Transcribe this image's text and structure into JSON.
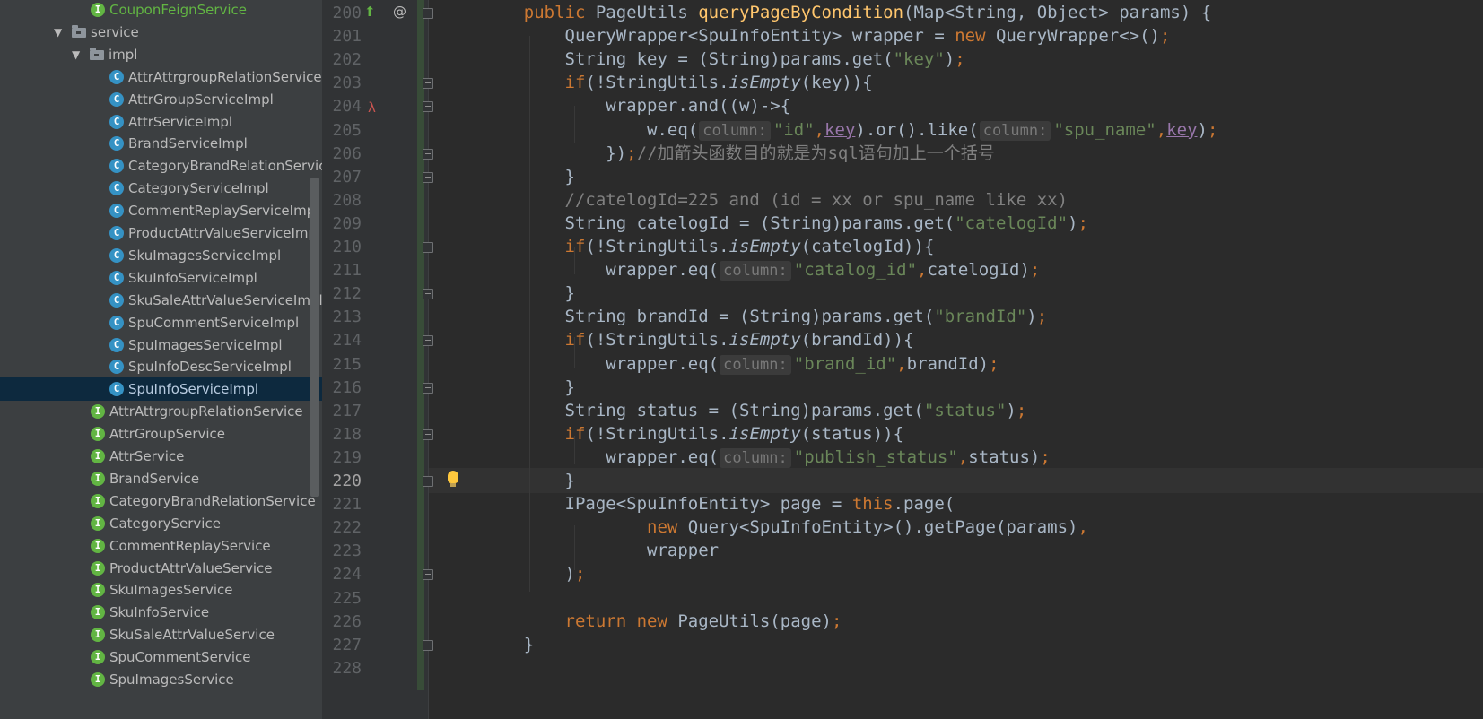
{
  "project_tree": {
    "items": [
      {
        "label": "CouponFeignService",
        "icon": "interface-icon",
        "kind": "i",
        "color": "#62b543"
      },
      {
        "label": "service",
        "icon": "package-icon",
        "kind": "dir",
        "expanded": true
      },
      {
        "label": "impl",
        "icon": "package-icon",
        "kind": "dir",
        "expanded": true
      },
      {
        "label": "AttrAttrgroupRelationServiceImpl",
        "icon": "class-icon",
        "kind": "c"
      },
      {
        "label": "AttrGroupServiceImpl",
        "icon": "class-icon",
        "kind": "c"
      },
      {
        "label": "AttrServiceImpl",
        "icon": "class-icon",
        "kind": "c"
      },
      {
        "label": "BrandServiceImpl",
        "icon": "class-icon",
        "kind": "c"
      },
      {
        "label": "CategoryBrandRelationServiceImpl",
        "icon": "class-icon",
        "kind": "c"
      },
      {
        "label": "CategoryServiceImpl",
        "icon": "class-icon",
        "kind": "c"
      },
      {
        "label": "CommentReplayServiceImpl",
        "icon": "class-icon",
        "kind": "c"
      },
      {
        "label": "ProductAttrValueServiceImpl",
        "icon": "class-icon",
        "kind": "c"
      },
      {
        "label": "SkuImagesServiceImpl",
        "icon": "class-icon",
        "kind": "c"
      },
      {
        "label": "SkuInfoServiceImpl",
        "icon": "class-icon",
        "kind": "c"
      },
      {
        "label": "SkuSaleAttrValueServiceImpl",
        "icon": "class-icon",
        "kind": "c"
      },
      {
        "label": "SpuCommentServiceImpl",
        "icon": "class-icon",
        "kind": "c"
      },
      {
        "label": "SpuImagesServiceImpl",
        "icon": "class-icon",
        "kind": "c"
      },
      {
        "label": "SpuInfoDescServiceImpl",
        "icon": "class-icon",
        "kind": "c"
      },
      {
        "label": "SpuInfoServiceImpl",
        "icon": "class-icon",
        "kind": "c",
        "selected": true
      },
      {
        "label": "AttrAttrgroupRelationService",
        "icon": "interface-icon",
        "kind": "i"
      },
      {
        "label": "AttrGroupService",
        "icon": "interface-icon",
        "kind": "i"
      },
      {
        "label": "AttrService",
        "icon": "interface-icon",
        "kind": "i"
      },
      {
        "label": "BrandService",
        "icon": "interface-icon",
        "kind": "i"
      },
      {
        "label": "CategoryBrandRelationService",
        "icon": "interface-icon",
        "kind": "i"
      },
      {
        "label": "CategoryService",
        "icon": "interface-icon",
        "kind": "i"
      },
      {
        "label": "CommentReplayService",
        "icon": "interface-icon",
        "kind": "i"
      },
      {
        "label": "ProductAttrValueService",
        "icon": "interface-icon",
        "kind": "i"
      },
      {
        "label": "SkuImagesService",
        "icon": "interface-icon",
        "kind": "i"
      },
      {
        "label": "SkuInfoService",
        "icon": "interface-icon",
        "kind": "i"
      },
      {
        "label": "SkuSaleAttrValueService",
        "icon": "interface-icon",
        "kind": "i"
      },
      {
        "label": "SpuCommentService",
        "icon": "interface-icon",
        "kind": "i"
      },
      {
        "label": "SpuImagesService",
        "icon": "interface-icon",
        "kind": "i"
      }
    ],
    "icon_letters": {
      "c": "C",
      "i": "I"
    }
  },
  "editor": {
    "current_line": "220",
    "gutter_markers": {
      "200": "override-up-icon at-icon",
      "204": "lambda-icon"
    },
    "lines": [
      {
        "n": "200",
        "tokens": [
          [
            "    ",
            ""
          ],
          [
            "public ",
            "kw"
          ],
          [
            "PageUtils ",
            ""
          ],
          [
            "queryPageByCondition",
            "fn"
          ],
          [
            "(Map<String, Object> params) {",
            ""
          ]
        ]
      },
      {
        "n": "201",
        "tokens": [
          [
            "        QueryWrapper<SpuInfoEntity> wrapper = ",
            ""
          ],
          [
            "new ",
            "kw"
          ],
          [
            "QueryWrapper<>()",
            ""
          ],
          [
            ";",
            "kw"
          ]
        ]
      },
      {
        "n": "202",
        "tokens": [
          [
            "        String key = (String)params.get(",
            ""
          ],
          [
            "\"key\"",
            "st"
          ],
          [
            ")",
            ""
          ],
          [
            ";",
            "kw"
          ]
        ]
      },
      {
        "n": "203",
        "tokens": [
          [
            "        ",
            ""
          ],
          [
            "if",
            "kw"
          ],
          [
            "(!StringUtils.",
            ""
          ],
          [
            "isEmpty",
            "it"
          ],
          [
            "(key)){",
            ""
          ]
        ]
      },
      {
        "n": "204",
        "tokens": [
          [
            "            wrapper.and((w)->{",
            ""
          ]
        ]
      },
      {
        "n": "205",
        "tokens": [
          [
            "                w.eq(",
            ""
          ],
          [
            "column:",
            "hint"
          ],
          [
            "\"id\"",
            "st"
          ],
          [
            ",",
            "kw"
          ],
          [
            "key",
            "pr"
          ],
          [
            ").or().like(",
            ""
          ],
          [
            "column:",
            "hint"
          ],
          [
            "\"spu_name\"",
            "st"
          ],
          [
            ",",
            "kw"
          ],
          [
            "key",
            "pr"
          ],
          [
            ")",
            ""
          ],
          [
            ";",
            "kw"
          ]
        ]
      },
      {
        "n": "206",
        "tokens": [
          [
            "            })",
            ""
          ],
          [
            ";",
            "kw"
          ],
          [
            "//加箭头函数目的就是为sql语句加上一个括号",
            "cm"
          ]
        ]
      },
      {
        "n": "207",
        "tokens": [
          [
            "        }",
            ""
          ]
        ]
      },
      {
        "n": "208",
        "tokens": [
          [
            "        //catelogId=225 and (id = xx or spu_name like xx)",
            "cm"
          ]
        ]
      },
      {
        "n": "209",
        "tokens": [
          [
            "        String catelogId = (String)params.get(",
            ""
          ],
          [
            "\"catelogId\"",
            "st"
          ],
          [
            ")",
            ""
          ],
          [
            ";",
            "kw"
          ]
        ]
      },
      {
        "n": "210",
        "tokens": [
          [
            "        ",
            ""
          ],
          [
            "if",
            "kw"
          ],
          [
            "(!StringUtils.",
            ""
          ],
          [
            "isEmpty",
            "it"
          ],
          [
            "(catelogId)){",
            ""
          ]
        ]
      },
      {
        "n": "211",
        "tokens": [
          [
            "            wrapper.eq(",
            ""
          ],
          [
            "column:",
            "hint"
          ],
          [
            "\"catalog_id\"",
            "st"
          ],
          [
            ",",
            "kw"
          ],
          [
            "catelogId)",
            ""
          ],
          [
            ";",
            "kw"
          ]
        ]
      },
      {
        "n": "212",
        "tokens": [
          [
            "        }",
            ""
          ]
        ]
      },
      {
        "n": "213",
        "tokens": [
          [
            "        String brandId = (String)params.get(",
            ""
          ],
          [
            "\"brandId\"",
            "st"
          ],
          [
            ")",
            ""
          ],
          [
            ";",
            "kw"
          ]
        ]
      },
      {
        "n": "214",
        "tokens": [
          [
            "        ",
            ""
          ],
          [
            "if",
            "kw"
          ],
          [
            "(!StringUtils.",
            ""
          ],
          [
            "isEmpty",
            "it"
          ],
          [
            "(brandId)){",
            ""
          ]
        ]
      },
      {
        "n": "215",
        "tokens": [
          [
            "            wrapper.eq(",
            ""
          ],
          [
            "column:",
            "hint"
          ],
          [
            "\"brand_id\"",
            "st"
          ],
          [
            ",",
            "kw"
          ],
          [
            "brandId)",
            ""
          ],
          [
            ";",
            "kw"
          ]
        ]
      },
      {
        "n": "216",
        "tokens": [
          [
            "        }",
            ""
          ]
        ]
      },
      {
        "n": "217",
        "tokens": [
          [
            "        String status = (String)params.get(",
            ""
          ],
          [
            "\"status\"",
            "st"
          ],
          [
            ")",
            ""
          ],
          [
            ";",
            "kw"
          ]
        ]
      },
      {
        "n": "218",
        "tokens": [
          [
            "        ",
            ""
          ],
          [
            "if",
            "kw"
          ],
          [
            "(!StringUtils.",
            ""
          ],
          [
            "isEmpty",
            "it"
          ],
          [
            "(status)){",
            ""
          ]
        ]
      },
      {
        "n": "219",
        "tokens": [
          [
            "            wrapper.eq(",
            ""
          ],
          [
            "column:",
            "hint"
          ],
          [
            "\"publish_status\"",
            "st"
          ],
          [
            ",",
            "kw"
          ],
          [
            "status)",
            ""
          ],
          [
            ";",
            "kw"
          ]
        ]
      },
      {
        "n": "220",
        "tokens": [
          [
            "        }",
            ""
          ]
        ]
      },
      {
        "n": "221",
        "tokens": [
          [
            "        IPage<SpuInfoEntity> page = ",
            ""
          ],
          [
            "this",
            "kw"
          ],
          [
            ".page(",
            ""
          ]
        ]
      },
      {
        "n": "222",
        "tokens": [
          [
            "                ",
            ""
          ],
          [
            "new ",
            "kw"
          ],
          [
            "Query<SpuInfoEntity>().getPage(params)",
            ""
          ],
          [
            ",",
            "kw"
          ]
        ]
      },
      {
        "n": "223",
        "tokens": [
          [
            "                wrapper",
            ""
          ]
        ]
      },
      {
        "n": "224",
        "tokens": [
          [
            "        )",
            ""
          ],
          [
            ";",
            "kw"
          ]
        ]
      },
      {
        "n": "225",
        "tokens": [
          [
            "",
            ""
          ]
        ]
      },
      {
        "n": "226",
        "tokens": [
          [
            "        ",
            ""
          ],
          [
            "return ",
            "kw"
          ],
          [
            "new ",
            "kw"
          ],
          [
            "PageUtils(page)",
            ""
          ],
          [
            ";",
            "kw"
          ]
        ]
      },
      {
        "n": "227",
        "tokens": [
          [
            "    }",
            ""
          ]
        ]
      },
      {
        "n": "228",
        "tokens": [
          [
            "",
            ""
          ]
        ]
      }
    ]
  },
  "colors": {
    "keyword": "#cc7832",
    "method": "#ffc66d",
    "string": "#6a8759",
    "comment": "#808080",
    "text": "#a9b7c6",
    "selection": "#0d293e"
  }
}
